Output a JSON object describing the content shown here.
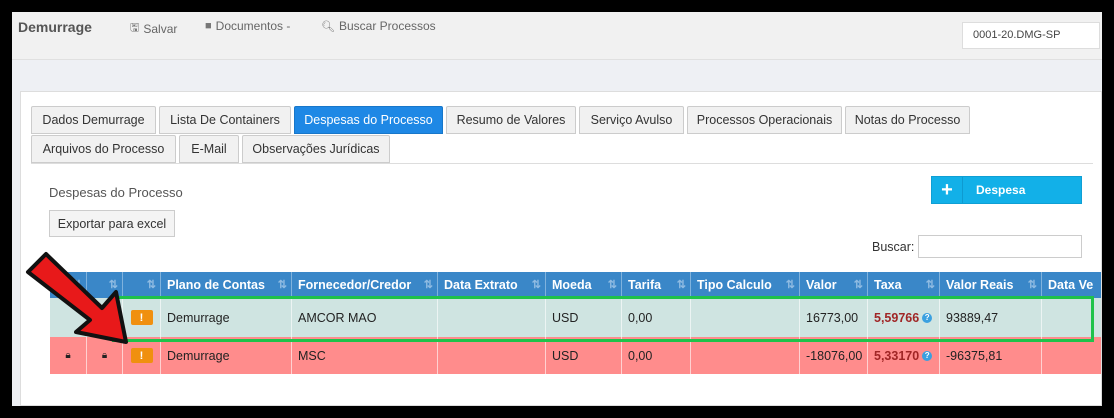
{
  "navbar": {
    "brand": "Demurrage",
    "items": [
      {
        "label": "Salvar",
        "icon": "save-icon"
      },
      {
        "label": "Documentos -",
        "icon": "folder-icon"
      },
      {
        "label": "Buscar Processos",
        "icon": "search-icon"
      }
    ],
    "process_selector": "0001-20.DMG-SP"
  },
  "tabs_row1": [
    "Dados Demurrage",
    "Lista De Containers",
    "Despesas do Processo",
    "Resumo de Valores",
    "Serviço Avulso",
    "Processos Operacionais",
    "Notas do Processo"
  ],
  "tabs_row2": [
    "Arquivos do Processo",
    "E-Mail",
    "Observações Jurídicas"
  ],
  "active_tab": "Despesas do Processo",
  "section": {
    "title": "Despesas do Processo",
    "add_button": "Despesa",
    "export_button": "Exportar para excel",
    "search_label": "Buscar:"
  },
  "table": {
    "headers": [
      "",
      "",
      "",
      "Plano de Contas",
      "Fornecedor/Credor",
      "Data Extrato",
      "Moeda",
      "Tarifa",
      "Tipo Calculo",
      "Valor",
      "Taxa",
      "Valor Reais",
      "Data Ve"
    ],
    "rows": [
      {
        "plano": "Demurrage",
        "fornecedor": "AMCOR MAO",
        "data_extrato": "",
        "moeda": "USD",
        "tarifa": "0,00",
        "tipo_calculo": "",
        "valor": "16773,00",
        "taxa": "5,59766",
        "valor_reais": "93889,47",
        "data_ve": "",
        "status": "highlighted"
      },
      {
        "plano": "Demurrage",
        "fornecedor": "MSC",
        "data_extrato": "",
        "moeda": "USD",
        "tarifa": "0,00",
        "tipo_calculo": "",
        "valor": "-18076,00",
        "taxa": "5,33170",
        "valor_reais": "-96375,81",
        "data_ve": "",
        "status": "locked"
      }
    ]
  },
  "colors": {
    "active_tab": "#1e88e5",
    "header": "#3a87c8",
    "row_highlight": "#cfe4e1",
    "row_locked": "#ff8c8c",
    "warning": "#f0900f",
    "annotation_box": "#1fc24a",
    "annotation_arrow": "#e8191a"
  }
}
